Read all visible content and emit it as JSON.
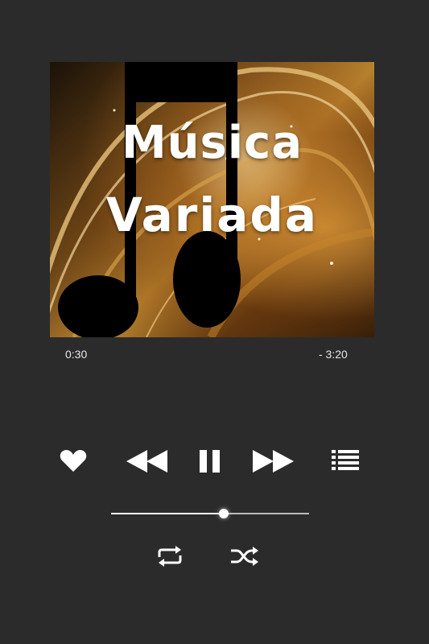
{
  "album_art": {
    "title_line1": "Música",
    "title_line2": "Variada"
  },
  "progress": {
    "elapsed": "0:30",
    "remaining": "- 3:20",
    "fraction": 0.57
  },
  "controls": {
    "favorite": "heart-icon",
    "previous": "rewind-icon",
    "play_pause": "pause-icon",
    "next": "fast-forward-icon",
    "playlist": "list-icon",
    "repeat": "repeat-icon",
    "shuffle": "shuffle-icon"
  },
  "colors": {
    "background": "#2b2b2b",
    "icon": "#ffffff"
  }
}
